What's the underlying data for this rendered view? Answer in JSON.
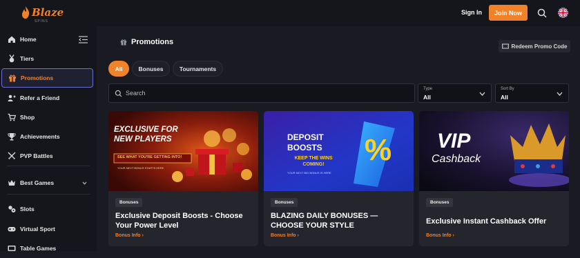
{
  "header": {
    "logo_text": "Blaze",
    "logo_sub": "SPINS",
    "signin_label": "Sign In",
    "join_label": "Join Now"
  },
  "sidebar": {
    "items": [
      {
        "label": "Home",
        "icon": "home-icon"
      },
      {
        "label": "Tiers",
        "icon": "medal-icon"
      },
      {
        "label": "Promotions",
        "icon": "gift-icon",
        "active": true
      },
      {
        "label": "Refer a Friend",
        "icon": "refer-icon"
      },
      {
        "label": "Shop",
        "icon": "cart-icon"
      },
      {
        "label": "Achievements",
        "icon": "trophy-icon"
      },
      {
        "label": "PVP Battles",
        "icon": "battle-icon"
      },
      {
        "label": "Best Games",
        "icon": "crown-icon"
      },
      {
        "label": "Slots",
        "icon": "slots-icon"
      },
      {
        "label": "Virtual Sport",
        "icon": "gamepad-icon"
      },
      {
        "label": "Table Games",
        "icon": "table-icon"
      }
    ]
  },
  "main": {
    "title": "Promotions",
    "redeem_label": "Redeem Promo Code",
    "tabs": [
      {
        "label": "All",
        "active": true
      },
      {
        "label": "Bonuses"
      },
      {
        "label": "Tournaments"
      }
    ],
    "search_placeholder": "Search",
    "filters": [
      {
        "label": "Type",
        "value": "All"
      },
      {
        "label": "Sort By",
        "value": "All"
      }
    ],
    "cards": [
      {
        "badge": "Bonuses",
        "title": "Exclusive Deposit Boosts - Choose Your Power Level",
        "link": "Bonus Info",
        "banner_line1": "EXCLUSIVE FOR",
        "banner_line2": "NEW PLAYERS",
        "banner_cta": "SEE WHAT YOU'RE GETTING INTO!",
        "banner_foot": "YOUR NEXT BONUS STARTS HERE"
      },
      {
        "badge": "Bonuses",
        "title": "BLAZING DAILY BONUSES — CHOOSE YOUR STYLE",
        "link": "Bonus Info",
        "banner_line1": "DEPOSIT",
        "banner_line2": "BOOSTS",
        "banner_sub1": "KEEP THE WINS",
        "banner_sub2": "COMING!",
        "banner_foot": "YOUR NEXT BIG BONUS IS HERE",
        "banner_symbol": "%"
      },
      {
        "badge": "Bonuses",
        "title": "Exclusive Instant Cashback Offer",
        "link": "Bonus Info",
        "banner_line1": "VIP",
        "banner_line2": "Cashback"
      }
    ]
  },
  "colors": {
    "accent": "#f0822a",
    "bg": "#1a1b22",
    "sidebar_bg": "#15161c",
    "active_border": "#6b6fd8"
  }
}
